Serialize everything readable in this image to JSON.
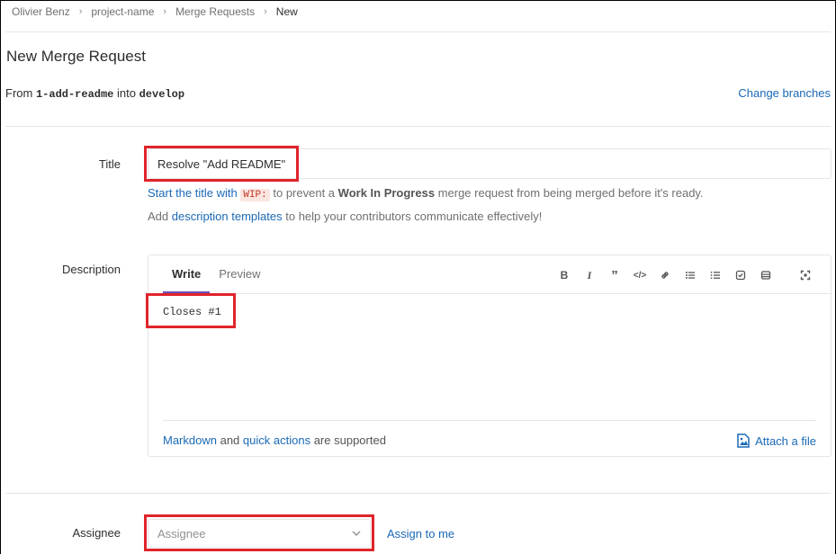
{
  "breadcrumb": {
    "items": [
      "Olivier Benz",
      "project-name",
      "Merge Requests"
    ],
    "current": "New"
  },
  "page": {
    "title": "New Merge Request",
    "from_prefix": "From",
    "source_branch": "1-add-readme",
    "into_text": "into",
    "target_branch": "develop",
    "change_branches": "Change branches"
  },
  "title_field": {
    "label": "Title",
    "value": "Resolve \"Add README\"",
    "hint_link": "Start the title with",
    "hint_code": "WIP:",
    "hint_middle": "to prevent a",
    "hint_strong": "Work In Progress",
    "hint_end": "merge request from being merged before it's ready.",
    "templates_prefix": "Add",
    "templates_link": "description templates",
    "templates_suffix": "to help your contributors communicate effectively!"
  },
  "description": {
    "label": "Description",
    "tabs": [
      "Write",
      "Preview"
    ],
    "value": "Closes #1",
    "markdown_link": "Markdown",
    "and_text": "and",
    "quick_actions_link": "quick actions",
    "supported_text": "are supported",
    "attach_file": "Attach a file",
    "toolbar_icons": [
      "bold-icon",
      "italic-icon",
      "quote-icon",
      "code-icon",
      "link-icon",
      "bullet-list-icon",
      "numbered-list-icon",
      "task-list-icon",
      "table-icon",
      "fullscreen-icon"
    ]
  },
  "assignee": {
    "label": "Assignee",
    "placeholder": "Assignee",
    "assign_to_me": "Assign to me"
  },
  "colors": {
    "link": "#1b69b6",
    "highlight_box": "#e0242b",
    "active_tab": "#6b4fbb"
  }
}
